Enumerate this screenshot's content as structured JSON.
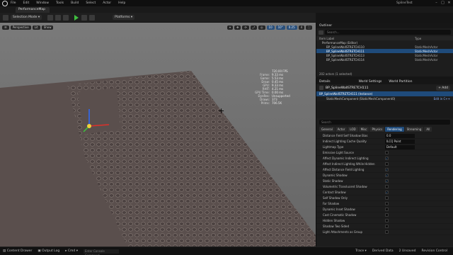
{
  "menu": [
    "File",
    "Edit",
    "Window",
    "Tools",
    "Build",
    "Select",
    "Actor",
    "Help"
  ],
  "app_title": "SplineTest",
  "map_tab": "PerformanceMap",
  "toolbar": {
    "mode": "Selection Mode",
    "platforms": "Platforms"
  },
  "viewport": {
    "perspective": "Perspective",
    "lit": "Lit",
    "show": "Show",
    "grid_snap": "10",
    "rot_snap": "10°",
    "scale_snap": "0.25",
    "camera_speed": "4",
    "stats": [
      {
        "label": "",
        "value": "720.00 FPS"
      },
      {
        "label": "Frame:",
        "value": "9.33 ms"
      },
      {
        "label": "Game:",
        "value": "5.53 ms"
      },
      {
        "label": "Draw:",
        "value": "0.45 ms"
      },
      {
        "label": "GPU:",
        "value": "9.33 ms"
      },
      {
        "label": "RHIT:",
        "value": "4.21 ms"
      },
      {
        "label": "GPU Time:",
        "value": "0.00 ms"
      },
      {
        "label": "DynRes:",
        "value": "Unsupported"
      },
      {
        "label": "Draws:",
        "value": "373"
      },
      {
        "label": "Prims:",
        "value": "706.5K"
      }
    ]
  },
  "statusbar": {
    "content_drawer": "Content Drawer",
    "output_log": "Output Log",
    "cmd": "Cmd",
    "cmd_placeholder": "Enter Console Command",
    "trace": "Trace",
    "derived_data": "Derived Data",
    "unsaved": "2 Unsaved",
    "revision": "Revision Control"
  },
  "outliner": {
    "tab": "Outliner",
    "search_placeholder": "Search...",
    "col_item": "Item Label",
    "col_type": "Type",
    "rows": [
      {
        "name": "PerformanceMap (Editor)",
        "type": "",
        "selected": false
      },
      {
        "name": "BP_SplineWallSTRETCH110",
        "type": "StaticMeshActor",
        "selected": false
      },
      {
        "name": "BP_SplineWallSTRETCH111",
        "type": "StaticMeshActor",
        "selected": true
      },
      {
        "name": "BP_SplineWallSTRETCH113",
        "type": "StaticMeshActor",
        "selected": false
      },
      {
        "name": "BP_SplineWallSTRETCH114",
        "type": "StaticMeshActor",
        "selected": false
      }
    ],
    "count": "202 actors (1 selected)"
  },
  "details": {
    "tab": "Details",
    "world_settings": "World Settings",
    "world_partition": "World Partition",
    "actor_name": "BP_SplineWallSTRETCH111",
    "add_label": "+ Add",
    "instance_row": "BP_SplineWallSTRETCH111 (Instance)",
    "component_row": "StaticMeshComponent (StaticMeshComponent0)",
    "edit_cpp": "Edit in C++",
    "search_placeholder": "Search",
    "categories": [
      "General",
      "Actor",
      "LOD",
      "Misc",
      "Physics",
      "Rendering",
      "Streaming",
      "All"
    ],
    "active_category": "Rendering",
    "props": [
      {
        "name": "Distance Field Self Shadow Bias",
        "kind": "value",
        "value": "0.0",
        "checked": false
      },
      {
        "name": "Indirect Lighting Cache Quality",
        "kind": "value",
        "value": "ILCQ Point",
        "checked": false
      },
      {
        "name": "Lightmap Type",
        "kind": "value",
        "value": "Default",
        "checked": false
      },
      {
        "name": "Emissive Light Source",
        "kind": "check",
        "value": "",
        "checked": false
      },
      {
        "name": "Affect Dynamic Indirect Lighting",
        "kind": "check",
        "value": "",
        "checked": true
      },
      {
        "name": "Affect Indirect Lighting While Hidden",
        "kind": "check",
        "value": "",
        "checked": false
      },
      {
        "name": "Affect Distance Field Lighting",
        "kind": "check",
        "value": "",
        "checked": true
      },
      {
        "name": "Dynamic Shadow",
        "kind": "check",
        "value": "",
        "checked": true
      },
      {
        "name": "Static Shadow",
        "kind": "check",
        "value": "",
        "checked": true
      },
      {
        "name": "Volumetric Translucent Shadow",
        "kind": "check",
        "value": "",
        "checked": false
      },
      {
        "name": "Contact Shadow",
        "kind": "check",
        "value": "",
        "checked": true
      },
      {
        "name": "Self Shadow Only",
        "kind": "check",
        "value": "",
        "checked": false
      },
      {
        "name": "Far Shadow",
        "kind": "check",
        "value": "",
        "checked": false
      },
      {
        "name": "Dynamic Inset Shadow",
        "kind": "check",
        "value": "",
        "checked": false
      },
      {
        "name": "Cast Cinematic Shadow",
        "kind": "check",
        "value": "",
        "checked": false
      },
      {
        "name": "Hidden Shadow",
        "kind": "check",
        "value": "",
        "checked": false
      },
      {
        "name": "Shadow Two Sided",
        "kind": "check",
        "value": "",
        "checked": false
      },
      {
        "name": "Light Attachments as Group",
        "kind": "check",
        "value": "",
        "checked": false
      }
    ]
  }
}
